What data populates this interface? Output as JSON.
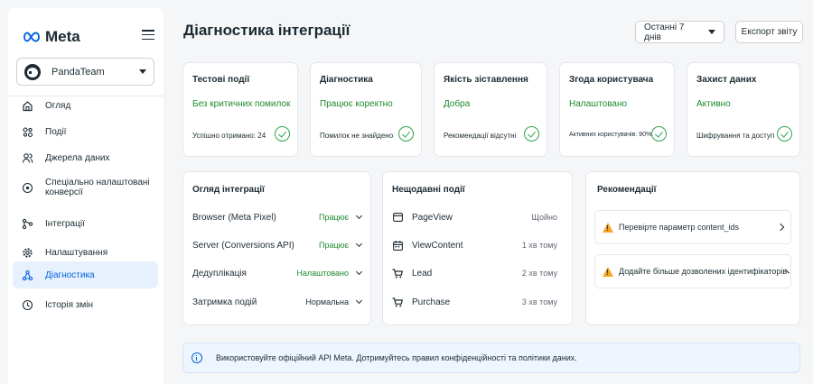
{
  "brand": {
    "name": "Meta",
    "icon": "meta-infinity-logo",
    "accent": "#0064e0",
    "success": "#1e8a2e",
    "warning": "#f5a623"
  },
  "team": {
    "name": "PandaTeam",
    "icon": "panda-avatar"
  },
  "nav": [
    {
      "label": "Огляд",
      "icon": "home-icon",
      "active": false
    },
    {
      "label": "Події",
      "icon": "events-icon",
      "active": false
    },
    {
      "label": "Джерела даних",
      "icon": "people-icon",
      "active": false
    },
    {
      "label": "Спеціально налаштовані конверсії",
      "icon": "target-icon",
      "active": false
    },
    {
      "label": "Інтеграції",
      "icon": "integrations-icon",
      "active": false
    },
    {
      "label": "Налаштування",
      "icon": "gear-icon",
      "active": false
    },
    {
      "label": "Діагностика",
      "icon": "diagnostics-icon",
      "active": true
    },
    {
      "label": "Історія змін",
      "icon": "clock-icon",
      "active": false
    }
  ],
  "header": {
    "title": "Діагностика інтеграції",
    "period": "Останні 7 днів",
    "export_label": "Експорт звіту"
  },
  "status_cards": [
    {
      "title": "Тестові події",
      "status": "Без критичних помилок",
      "detail": "Успішно отримано: 24"
    },
    {
      "title": "Діагностика",
      "status": "Працює коректно",
      "detail": "Помилок не знайдено"
    },
    {
      "title": "Якість зіставлення",
      "status": "Добра",
      "detail": "Рекомендації відсутні"
    },
    {
      "title": "Згода користувача",
      "status": "Налаштовано",
      "detail": "Активних користувачів: 90%"
    },
    {
      "title": "Захист даних",
      "status": "Активно",
      "detail": "Шифрування та доступ"
    }
  ],
  "overview": {
    "title": "Огляд інтеграції",
    "rows": [
      {
        "label": "Browser (Meta Pixel)",
        "value": "Працює",
        "state": "ok"
      },
      {
        "label": "Server (Conversions API)",
        "value": "Працює",
        "state": "ok"
      },
      {
        "label": "Дедуплікація",
        "value": "Налаштовано",
        "state": "ok"
      },
      {
        "label": "Затримка подій",
        "value": "Нормальна",
        "state": "neutral"
      }
    ]
  },
  "recent_events": {
    "title": "Нещодавні події",
    "items": [
      {
        "name": "PageView",
        "time": "Щойно",
        "icon": "browser-icon"
      },
      {
        "name": "ViewContent",
        "time": "1 хв тому",
        "icon": "calendar-icon"
      },
      {
        "name": "Lead",
        "time": "2 хв тому",
        "icon": "cart-icon"
      },
      {
        "name": "Purchase",
        "time": "3 хв тому",
        "icon": "cart-icon"
      }
    ]
  },
  "recommendations": {
    "title": "Рекомендації",
    "items": [
      {
        "text": "Перевірте параметр content_ids",
        "icon": "warning-icon"
      },
      {
        "text": "Додайте більше дозволених ідентифікаторів",
        "icon": "warning-icon"
      }
    ]
  },
  "footer_notice": {
    "text": "Використовуйте офіційний API Meta. Дотримуйтесь правил конфіденційності та політики даних.",
    "icon": "info-icon"
  }
}
